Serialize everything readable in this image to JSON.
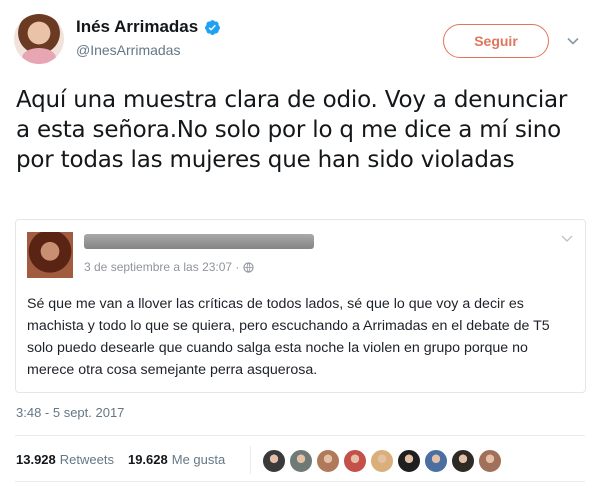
{
  "tweet": {
    "author": {
      "name": "Inés Arrimadas",
      "handle": "@InesArrimadas",
      "verified": true
    },
    "follow_label": "Seguir",
    "text": "Aquí una muestra clara de odio. Voy a denunciar a esta señora.No solo por lo q me dice a mí sino por todas las mujeres que han sido violadas",
    "embedded_post": {
      "date": "3 de septiembre a las 23:07 ·",
      "text": "Sé que me van a llover las críticas de todos lados, sé que lo que voy a decir es machista y todo lo que se quiera, pero escuchando a Arrimadas en el debate de T5 solo puedo desearle que cuando salga esta noche la violen en grupo porque no merece otra cosa semejante perra asquerosa."
    },
    "timestamp": "3:48 - 5 sept. 2017",
    "stats": {
      "retweets_count": "13.928",
      "retweets_label": "Retweets",
      "likes_count": "19.628",
      "likes_label": "Me gusta"
    },
    "liker_avatars": [
      {
        "color": "#3a3a3a"
      },
      {
        "color": "#6f7a76"
      },
      {
        "color": "#b07a5a"
      },
      {
        "color": "#c4504a"
      },
      {
        "color": "#d9b07a"
      },
      {
        "color": "#1f1f1f"
      },
      {
        "color": "#4a6fa0"
      },
      {
        "color": "#2e2a26"
      },
      {
        "color": "#a0705a"
      }
    ]
  },
  "colors": {
    "accent": "#e0755c",
    "verified": "#1da1f2",
    "muted": "#657786"
  }
}
